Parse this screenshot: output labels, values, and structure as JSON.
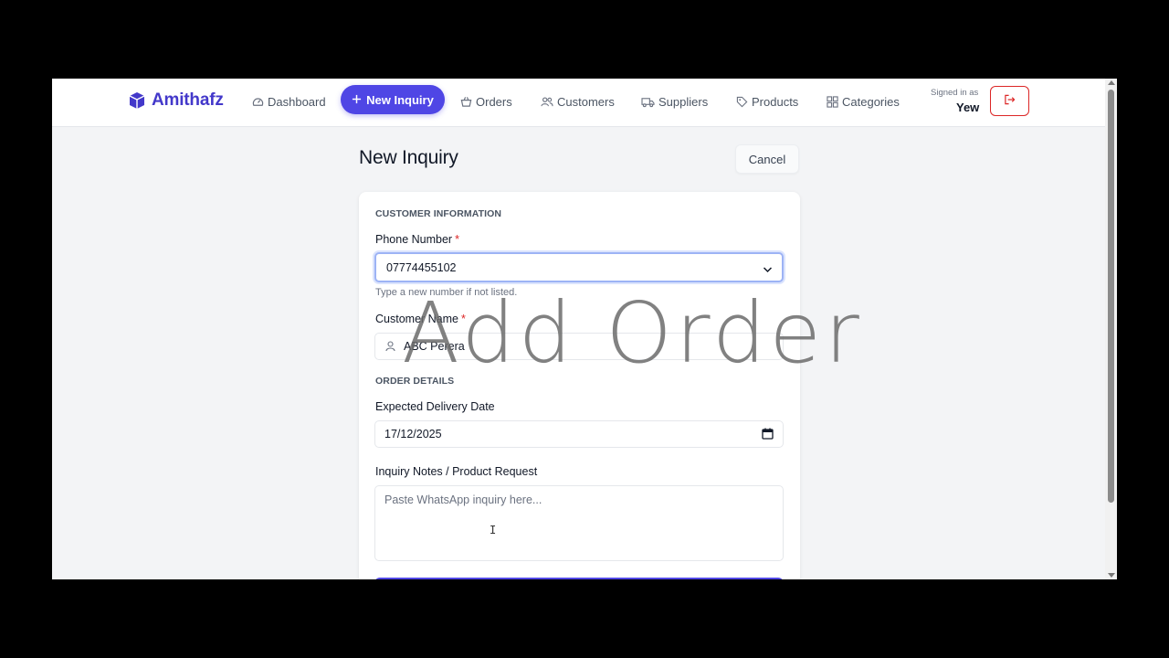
{
  "brand": {
    "name": "Amithafz",
    "icon": "cube-icon",
    "color": "#4338ca"
  },
  "nav": {
    "dashboard": {
      "label": "Dashboard",
      "icon": "gauge-icon"
    },
    "new_inquiry": {
      "label": "New Inquiry",
      "icon": "plus-icon"
    },
    "orders": {
      "label": "Orders",
      "icon": "basket-icon"
    },
    "customers": {
      "label": "Customers",
      "icon": "users-icon"
    },
    "suppliers": {
      "label": "Suppliers",
      "icon": "truck-icon"
    },
    "products": {
      "label": "Products",
      "icon": "tag-icon"
    },
    "categories": {
      "label": "Categories",
      "icon": "grid-icon"
    }
  },
  "user": {
    "signed_in_label": "Signed in as",
    "name": "Yew",
    "logout_icon": "logout-icon"
  },
  "page": {
    "title": "New Inquiry",
    "cancel_label": "Cancel"
  },
  "form": {
    "customer_section": "CUSTOMER INFORMATION",
    "phone": {
      "label": "Phone Number",
      "required": "*",
      "value": "07774455102",
      "help": "Type a new number if not listed."
    },
    "customer_name": {
      "label": "Customer Name",
      "required": "*",
      "value": "ABC Perera",
      "icon": "user-icon"
    },
    "order_section": "ORDER DETAILS",
    "delivery_date": {
      "label": "Expected Delivery Date",
      "value": "17/12/2025",
      "icon": "calendar-icon"
    },
    "notes": {
      "label": "Inquiry Notes / Product Request",
      "placeholder": "Paste WhatsApp inquiry here..."
    }
  },
  "annotation": {
    "text": "Add Order"
  },
  "colors": {
    "accent": "#4f46e5",
    "danger": "#dc2626",
    "background": "#f3f4f6"
  }
}
